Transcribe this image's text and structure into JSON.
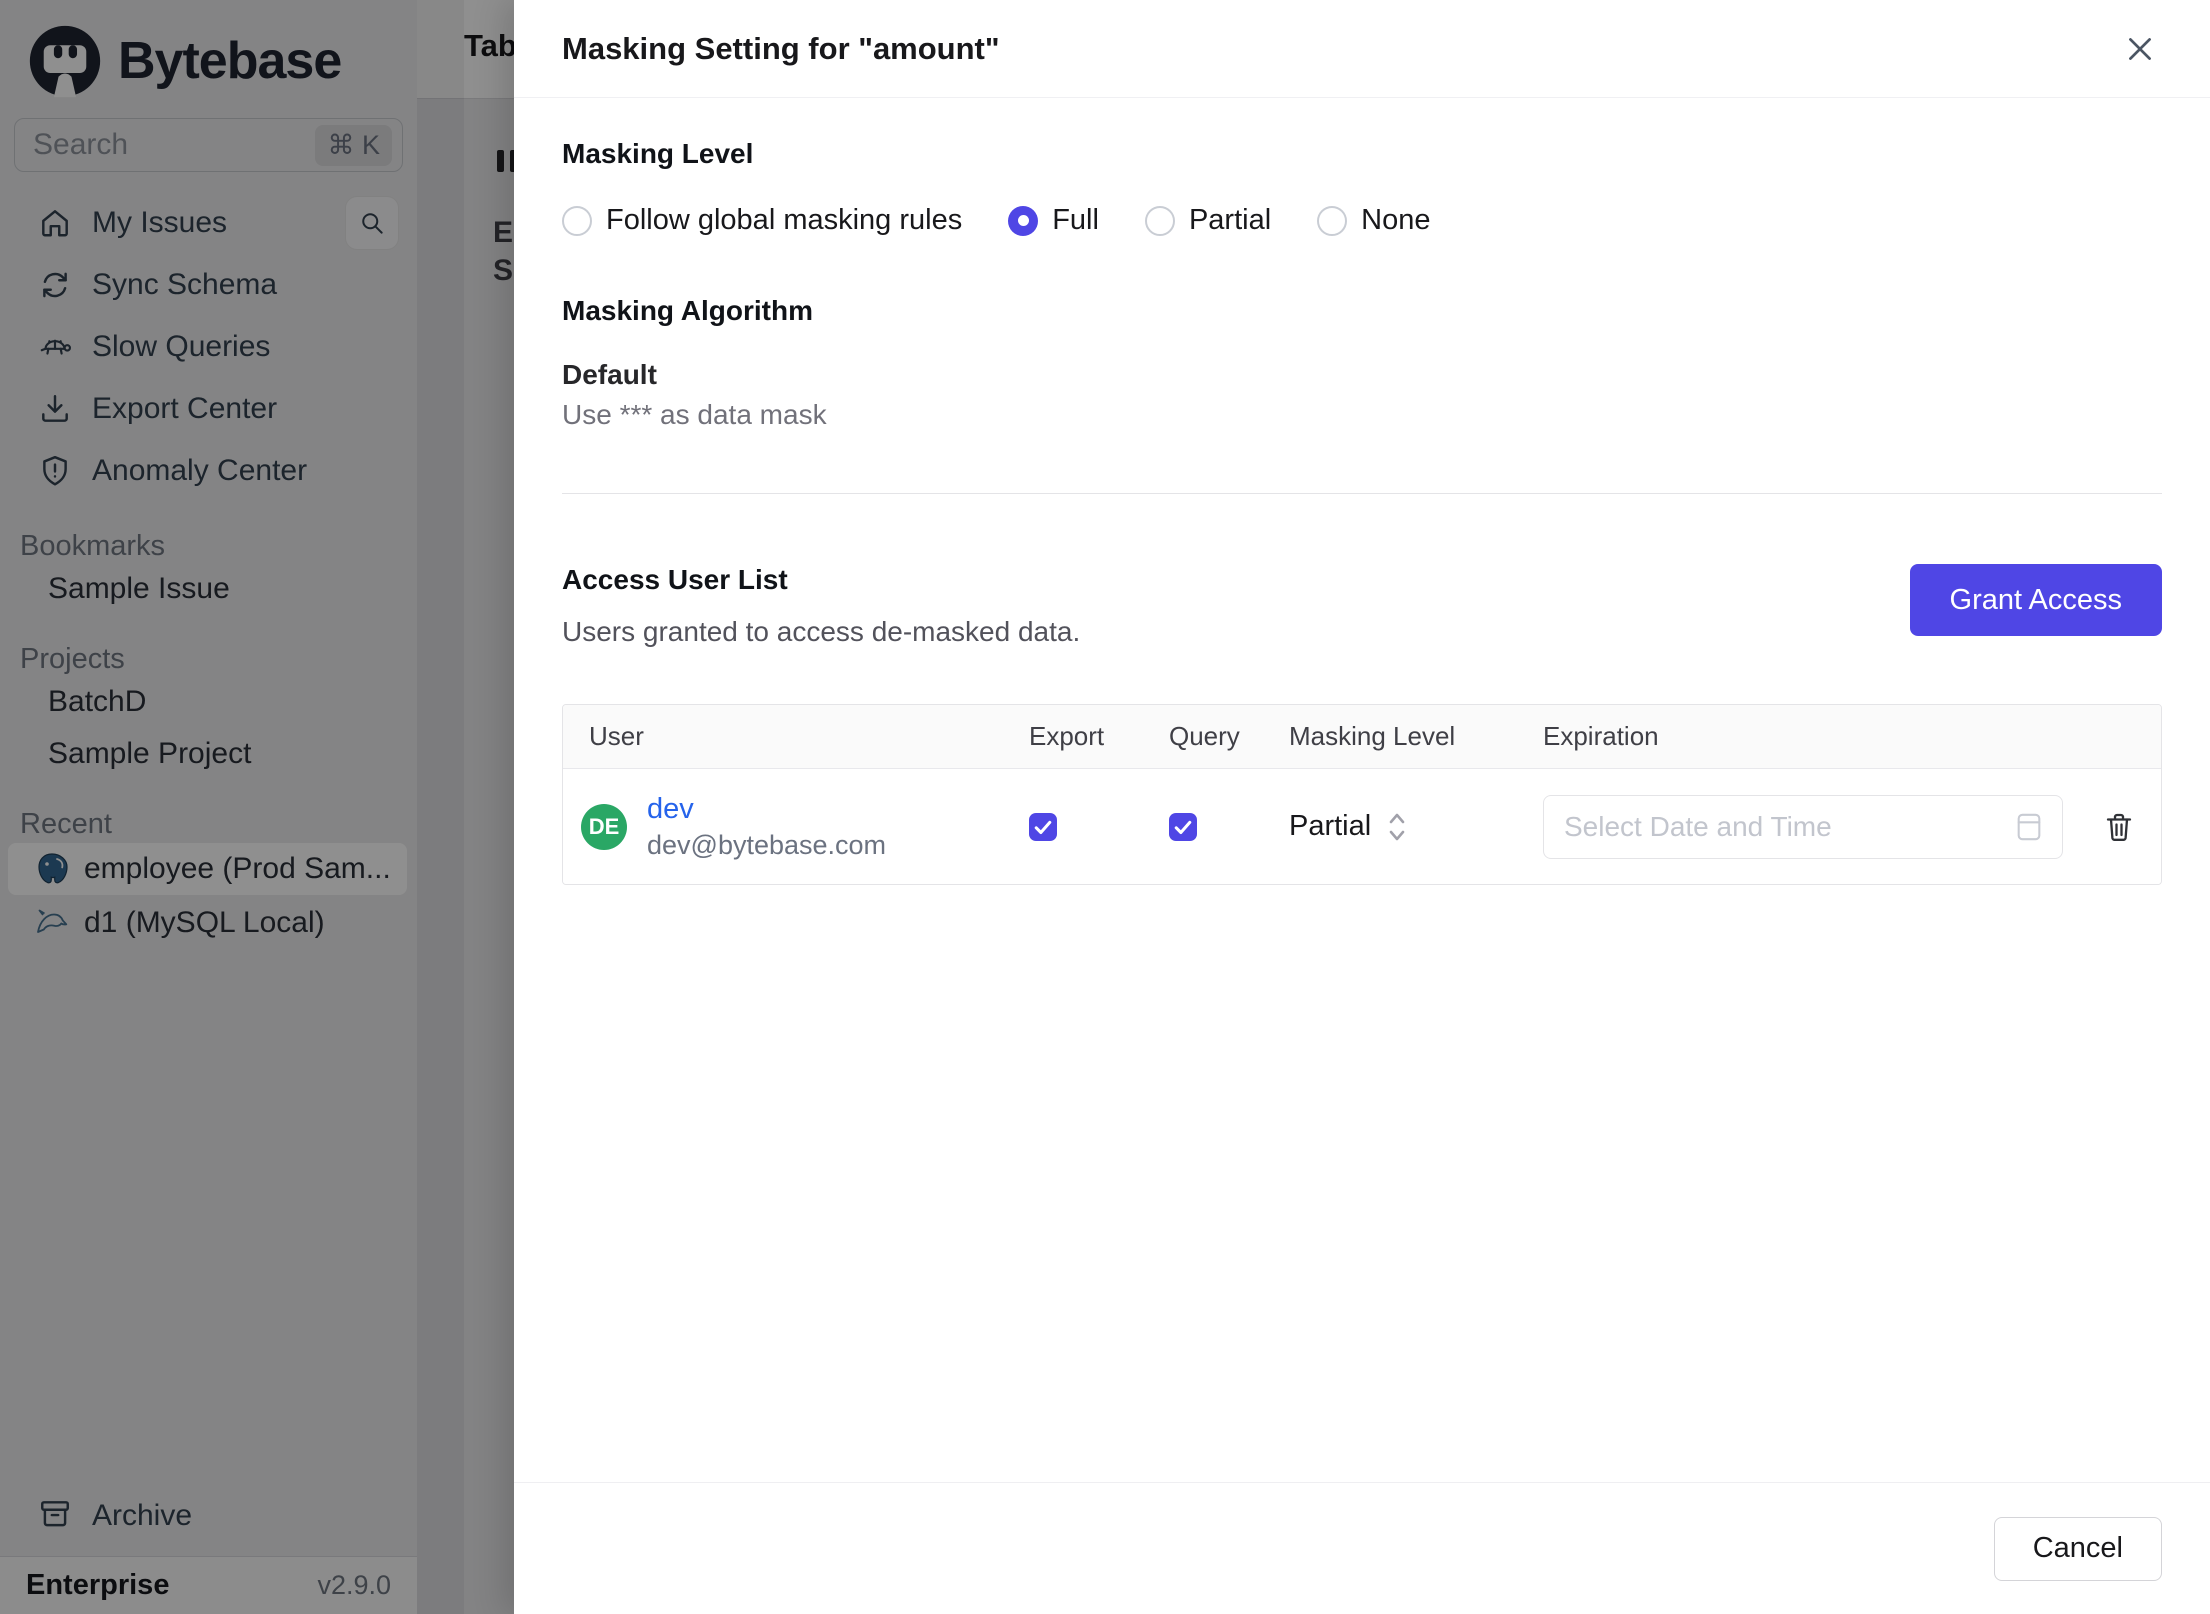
{
  "sidebar": {
    "brand": "Bytebase",
    "search": {
      "placeholder": "Search",
      "shortcut": "⌘ K"
    },
    "menu": [
      {
        "label": "My Issues",
        "icon": "home-icon"
      },
      {
        "label": "Sync Schema",
        "icon": "sync-icon"
      },
      {
        "label": "Slow Queries",
        "icon": "turtle-icon"
      },
      {
        "label": "Export Center",
        "icon": "download-icon"
      },
      {
        "label": "Anomaly Center",
        "icon": "shield-alert-icon"
      }
    ],
    "sections": [
      {
        "label": "Bookmarks",
        "items": [
          {
            "label": "Sample Issue"
          }
        ]
      },
      {
        "label": "Projects",
        "items": [
          {
            "label": "BatchD"
          },
          {
            "label": "Sample Project"
          }
        ]
      },
      {
        "label": "Recent",
        "items": [
          {
            "label": "employee (Prod Sam...",
            "icon": "postgresql-icon",
            "active": true
          },
          {
            "label": "d1 (MySQL Local)",
            "icon": "mysql-icon",
            "active": false
          }
        ]
      }
    ],
    "archive_label": "Archive",
    "footer": {
      "plan": "Enterprise",
      "version": "v2.9.0"
    }
  },
  "page_behind": {
    "title": "Tab",
    "fragment_e": "E",
    "fragment_s": "S"
  },
  "modal": {
    "title": "Masking Setting for \"amount\"",
    "masking_level": {
      "heading": "Masking Level",
      "options": [
        {
          "label": "Follow global masking rules",
          "selected": false
        },
        {
          "label": "Full",
          "selected": true
        },
        {
          "label": "Partial",
          "selected": false
        },
        {
          "label": "None",
          "selected": false
        }
      ]
    },
    "masking_algorithm": {
      "heading": "Masking Algorithm",
      "name": "Default",
      "description": "Use *** as data mask"
    },
    "access_user_list": {
      "heading": "Access User List",
      "subtitle": "Users granted to access de-masked data.",
      "grant_button": "Grant Access",
      "table": {
        "columns": [
          "User",
          "Export",
          "Query",
          "Masking Level",
          "Expiration"
        ],
        "rows": [
          {
            "avatar_initials": "DE",
            "name": "dev",
            "email": "dev@bytebase.com",
            "export_checked": true,
            "query_checked": true,
            "masking_level": "Partial",
            "expiration_placeholder": "Select Date and Time"
          }
        ]
      }
    },
    "cancel_label": "Cancel"
  },
  "colors": {
    "accent": "#4f46e5",
    "avatar_green": "#2aa765",
    "link_blue": "#2563eb"
  }
}
